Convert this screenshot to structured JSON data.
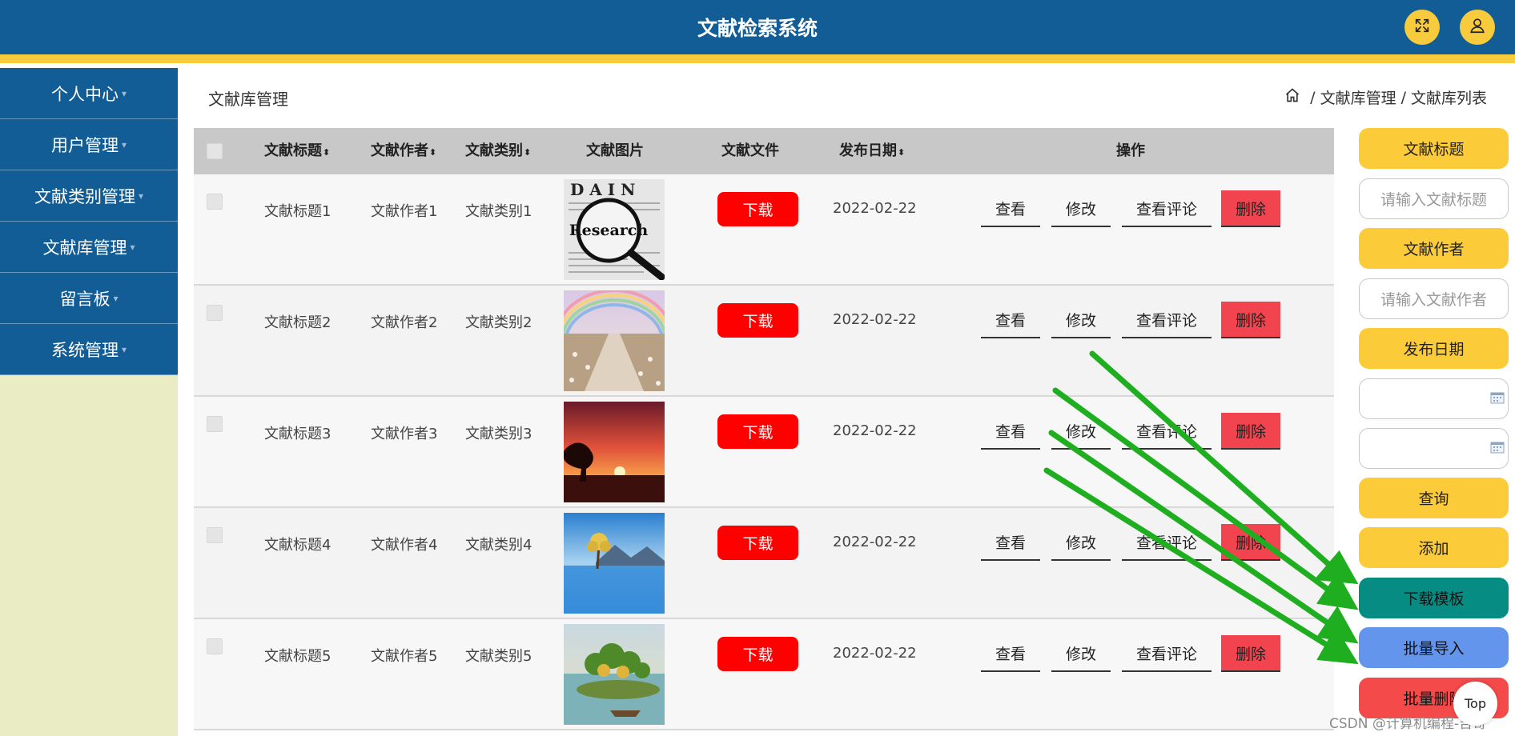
{
  "header": {
    "title": "文献检索系统"
  },
  "sidebar": {
    "items": [
      {
        "label": "个人中心"
      },
      {
        "label": "用户管理"
      },
      {
        "label": "文献类别管理"
      },
      {
        "label": "文献库管理"
      },
      {
        "label": "留言板"
      },
      {
        "label": "系统管理"
      }
    ]
  },
  "page": {
    "title": "文献库管理",
    "breadcrumb": [
      "文献库管理",
      "文献库列表"
    ],
    "breadcrumb_sep": "/"
  },
  "table": {
    "columns": [
      "文献标题",
      "文献作者",
      "文献类别",
      "文献图片",
      "文献文件",
      "发布日期",
      "操作"
    ],
    "sort_glyph": "⬍",
    "rows": [
      {
        "title": "文献标题1",
        "author": "文献作者1",
        "category": "文献类别1",
        "image": "research-magnifier",
        "file_btn": "下载",
        "date": "2022-02-22"
      },
      {
        "title": "文献标题2",
        "author": "文献作者2",
        "category": "文献类别2",
        "image": "rainbow-path",
        "file_btn": "下载",
        "date": "2022-02-22"
      },
      {
        "title": "文献标题3",
        "author": "文献作者3",
        "category": "文献类别3",
        "image": "sunset",
        "file_btn": "下载",
        "date": "2022-02-22"
      },
      {
        "title": "文献标题4",
        "author": "文献作者4",
        "category": "文献类别4",
        "image": "lake-tree",
        "file_btn": "下载",
        "date": "2022-02-22"
      },
      {
        "title": "文献标题5",
        "author": "文献作者5",
        "category": "文献类别5",
        "image": "island-painting",
        "file_btn": "下载",
        "date": "2022-02-22"
      }
    ],
    "ops": [
      "查看",
      "修改",
      "查看评论",
      "删除"
    ],
    "thumb_research_text": "Research"
  },
  "right_panel": {
    "title_label": "文献标题",
    "title_placeholder": "请输入文献标题",
    "author_label": "文献作者",
    "author_placeholder": "请输入文献作者",
    "date_label": "发布日期",
    "query": "查询",
    "add": "添加",
    "download_template": "下载模板",
    "batch_import": "批量导入",
    "batch_delete": "批量删除"
  },
  "top_button": "Top",
  "watermark": "CSDN @计算机编程-吉哥",
  "colors": {
    "header": "#135d96",
    "accent_yellow": "#f7cb3c",
    "download_red": "#ff0000",
    "delete_red": "#f2444f",
    "teal": "#078c84",
    "blue": "#6495ed",
    "arrow_green": "#1fae1f"
  },
  "icons": [
    "fullscreen-icon",
    "user-icon",
    "home-icon",
    "calendar-icon",
    "sort-icon"
  ]
}
